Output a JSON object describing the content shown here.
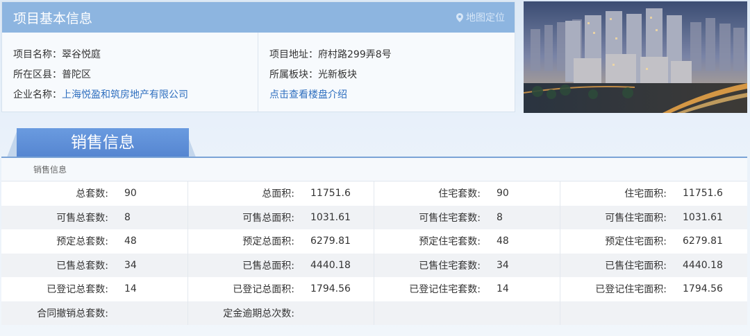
{
  "project": {
    "title": "项目基本信息",
    "map_link": "地图定位",
    "left_rows": [
      {
        "label": "项目名称：",
        "value": "翠谷悦庭"
      },
      {
        "label": "所在区县：",
        "value": "普陀区"
      },
      {
        "label": "企业名称：",
        "value": "上海悦盈和筑房地产有限公司"
      }
    ],
    "right_rows": [
      {
        "label": "项目地址：",
        "value": "府村路299弄8号"
      },
      {
        "label": "所属板块：",
        "value": "光新板块"
      }
    ],
    "intro_link": "点击查看楼盘介绍"
  },
  "sales": {
    "tab_label": "销售信息",
    "caption": "销售信息",
    "rows": [
      [
        {
          "label": "总套数:",
          "value": "90"
        },
        {
          "label": "总面积:",
          "value": "11751.6"
        },
        {
          "label": "住宅套数:",
          "value": "90"
        },
        {
          "label": "住宅面积:",
          "value": "11751.6"
        }
      ],
      [
        {
          "label": "可售总套数:",
          "value": "8"
        },
        {
          "label": "可售总面积:",
          "value": "1031.61"
        },
        {
          "label": "可售住宅套数:",
          "value": "8"
        },
        {
          "label": "可售住宅面积:",
          "value": "1031.61"
        }
      ],
      [
        {
          "label": "预定总套数:",
          "value": "48"
        },
        {
          "label": "预定总面积:",
          "value": "6279.81"
        },
        {
          "label": "预定住宅套数:",
          "value": "48"
        },
        {
          "label": "预定住宅面积:",
          "value": "6279.81"
        }
      ],
      [
        {
          "label": "已售总套数:",
          "value": "34"
        },
        {
          "label": "已售总面积:",
          "value": "4440.18"
        },
        {
          "label": "已售住宅套数:",
          "value": "34"
        },
        {
          "label": "已售住宅面积:",
          "value": "4440.18"
        }
      ],
      [
        {
          "label": "已登记总套数:",
          "value": "14"
        },
        {
          "label": "已登记总面积:",
          "value": "1794.56"
        },
        {
          "label": "已登记住宅套数:",
          "value": "14"
        },
        {
          "label": "已登记住宅面积:",
          "value": "1794.56"
        }
      ],
      [
        {
          "label": "合同撤销总套数:",
          "value": ""
        },
        {
          "label": "定金逾期总次数:",
          "value": ""
        },
        {
          "label": "",
          "value": ""
        },
        {
          "label": "",
          "value": ""
        }
      ]
    ]
  },
  "colors": {
    "header_bg": "#8db5e0",
    "tab_bg": "#5a8ad4",
    "link": "#2f6fbf"
  }
}
